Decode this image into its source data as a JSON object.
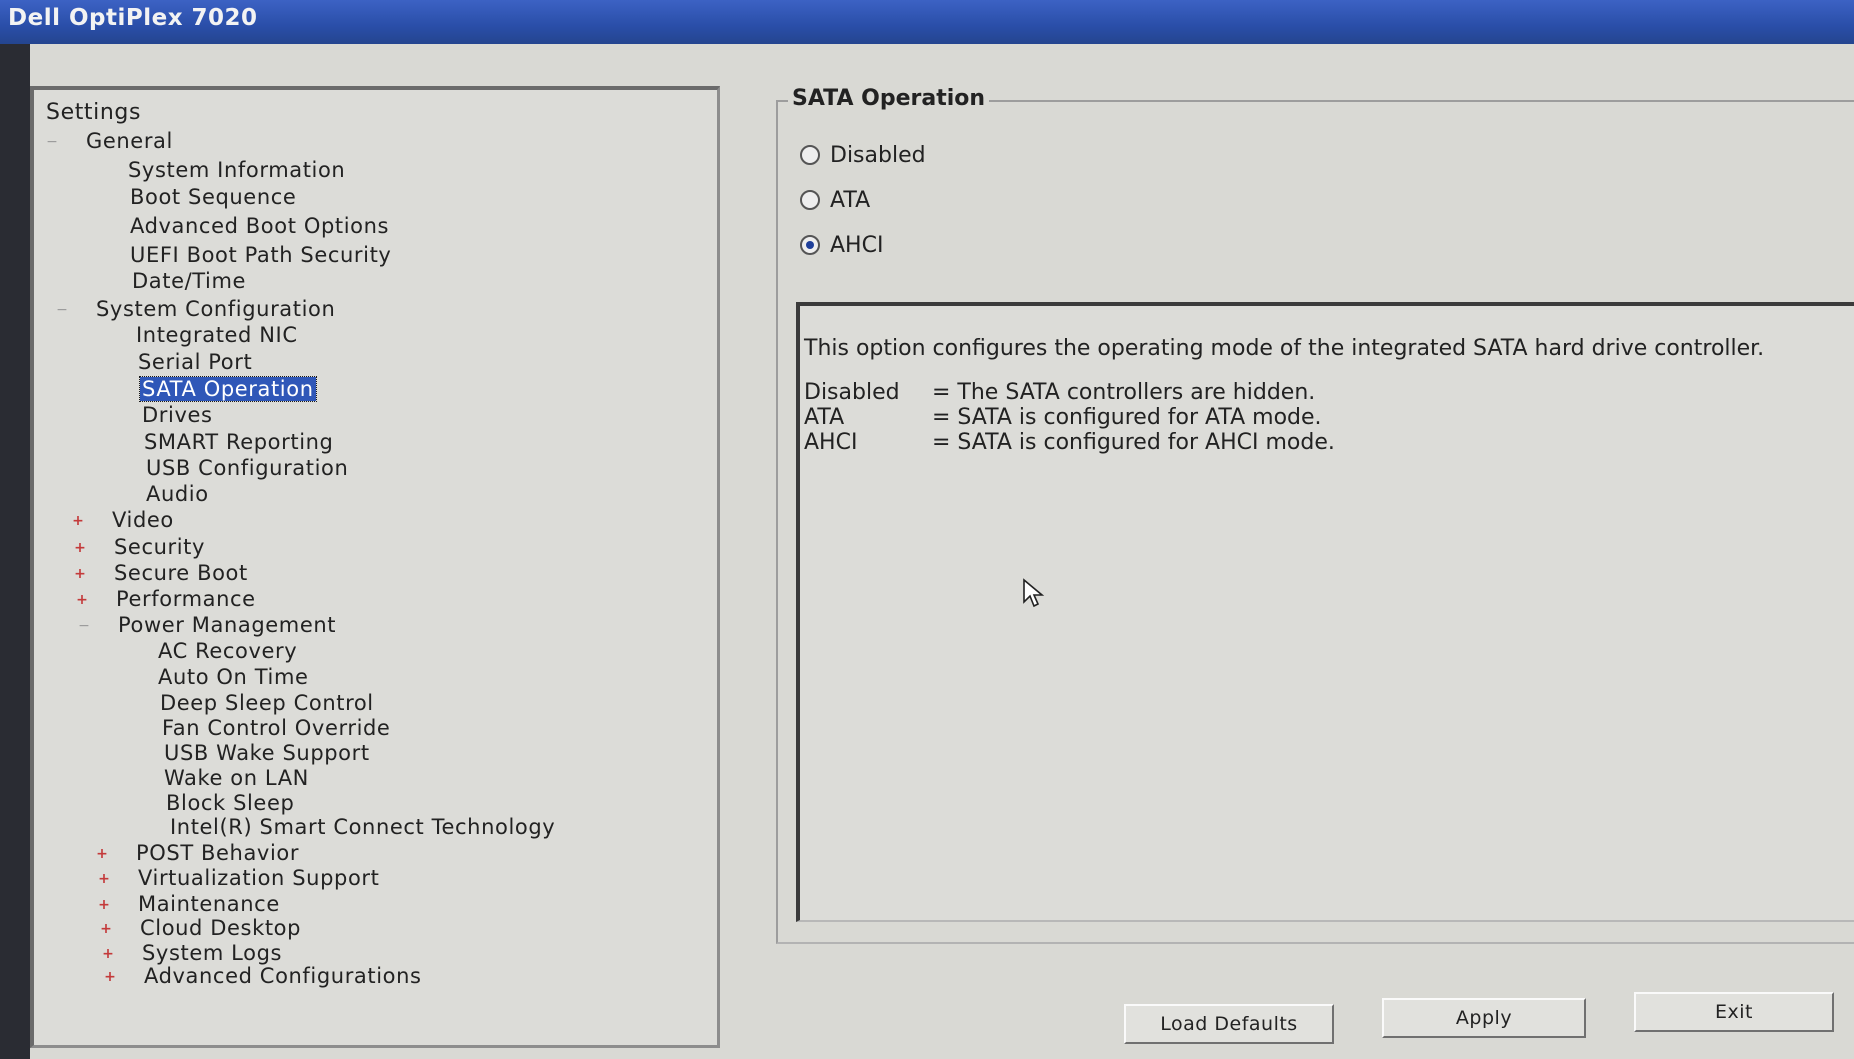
{
  "window": {
    "title": "Dell OptiPlex 7020"
  },
  "tree": {
    "root": "Settings",
    "nodes": [
      {
        "label": "General",
        "toggle": "minus"
      },
      {
        "label": "System Information"
      },
      {
        "label": "Boot Sequence"
      },
      {
        "label": "Advanced Boot Options"
      },
      {
        "label": "UEFI Boot Path Security"
      },
      {
        "label": "Date/Time"
      },
      {
        "label": "System Configuration",
        "toggle": "minus"
      },
      {
        "label": "Integrated NIC"
      },
      {
        "label": "Serial Port"
      },
      {
        "label": "SATA Operation",
        "selected": true
      },
      {
        "label": "Drives"
      },
      {
        "label": "SMART Reporting"
      },
      {
        "label": "USB Configuration"
      },
      {
        "label": "Audio"
      },
      {
        "label": "Video",
        "toggle": "plus"
      },
      {
        "label": "Security",
        "toggle": "plus"
      },
      {
        "label": "Secure Boot",
        "toggle": "plus"
      },
      {
        "label": "Performance",
        "toggle": "plus"
      },
      {
        "label": "Power Management",
        "toggle": "minus"
      },
      {
        "label": "AC Recovery"
      },
      {
        "label": "Auto On Time"
      },
      {
        "label": "Deep Sleep Control"
      },
      {
        "label": "Fan Control Override"
      },
      {
        "label": "USB Wake Support"
      },
      {
        "label": "Wake on LAN"
      },
      {
        "label": "Block Sleep"
      },
      {
        "label": "Intel(R) Smart Connect Technology"
      },
      {
        "label": "POST Behavior",
        "toggle": "plus"
      },
      {
        "label": "Virtualization Support",
        "toggle": "plus"
      },
      {
        "label": "Maintenance",
        "toggle": "plus"
      },
      {
        "label": "Cloud Desktop",
        "toggle": "plus"
      },
      {
        "label": "System Logs",
        "toggle": "plus"
      },
      {
        "label": "Advanced Configurations",
        "toggle": "plus"
      }
    ]
  },
  "sata": {
    "title": "SATA Operation",
    "options": [
      {
        "label": "Disabled",
        "selected": false
      },
      {
        "label": "ATA",
        "selected": false
      },
      {
        "label": "AHCI",
        "selected": true
      }
    ],
    "help": {
      "intro": "This option configures the operating mode of the integrated SATA hard drive controller.",
      "rows": [
        {
          "key": "Disabled",
          "value": "= The SATA controllers are hidden."
        },
        {
          "key": "ATA",
          "value": "= SATA is configured for ATA mode."
        },
        {
          "key": "AHCI",
          "value": "= SATA is configured for AHCI mode."
        }
      ]
    }
  },
  "buttons": {
    "load_defaults": "Load Defaults",
    "apply": "Apply",
    "exit": "Exit"
  },
  "colors": {
    "titlebar": "#2a4ea8",
    "selection": "#2f57b8",
    "panel": "#d9d9d4"
  },
  "icons": [
    "mouse-cursor-icon",
    "radio-icon",
    "expand-icon",
    "collapse-icon"
  ]
}
